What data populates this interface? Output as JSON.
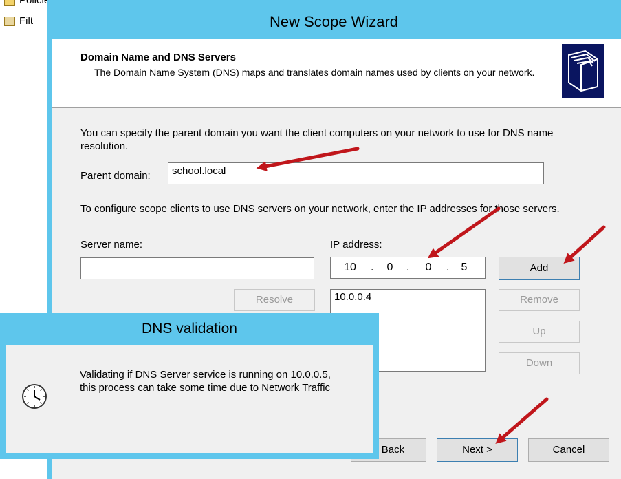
{
  "background_tree": {
    "items": [
      {
        "label": "Policies",
        "icon": "policies-folder-icon"
      },
      {
        "label": "Filt",
        "icon": "filters-icon"
      }
    ]
  },
  "wizard": {
    "title": "New Scope Wizard",
    "header": {
      "title": "Domain Name and DNS Servers",
      "description": "The Domain Name System (DNS) maps and translates domain names used by clients on your network."
    },
    "intro_text": "You can specify the parent domain you want the client computers on your network to use for DNS name resolution.",
    "parent_domain": {
      "label": "Parent domain:",
      "value": "school.local"
    },
    "dns_text": "To configure scope clients to use DNS servers on your network, enter the IP addresses for those servers.",
    "server_name": {
      "label": "Server name:",
      "value": ""
    },
    "ip_address": {
      "label": "IP address:",
      "octets": [
        "10",
        "0",
        "0",
        "5"
      ]
    },
    "ip_list": [
      "10.0.0.4"
    ],
    "buttons": {
      "resolve": "Resolve",
      "add": "Add",
      "remove": "Remove",
      "up": "Up",
      "down": "Down",
      "back": "< Back",
      "next": "Next >",
      "cancel": "Cancel"
    }
  },
  "dns_validation": {
    "title": "DNS validation",
    "message": "Validating if DNS Server service is running on 10.0.0.5, this process can take some time due to Network Traffic",
    "icon": "clock-icon"
  },
  "colors": {
    "title_bar": "#5ec6ec",
    "annotation_arrow": "#c0161b",
    "header_icon_bg": "#0a1560"
  }
}
